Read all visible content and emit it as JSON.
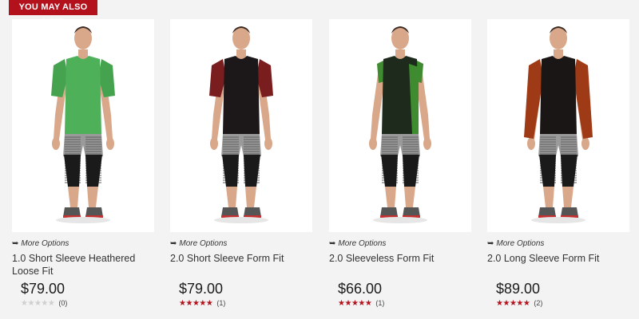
{
  "section": {
    "title": "YOU MAY ALSO LIKE"
  },
  "more_options_label": "More Options",
  "products": [
    {
      "name": "1.0 Short Sleeve Heathered Loose Fit",
      "price": "$79.00",
      "rating": 0,
      "review_count": "(0)",
      "shirt_color": "#4fb05a",
      "sleeve_color": "#45a350",
      "sleeve": "short-loose"
    },
    {
      "name": "2.0 Short Sleeve Form Fit",
      "price": "$79.00",
      "rating": 5,
      "review_count": "(1)",
      "shirt_color": "#1c1718",
      "sleeve_color": "#7a1d1f",
      "sleeve": "short"
    },
    {
      "name": "2.0 Sleeveless Form Fit",
      "price": "$66.00",
      "rating": 5,
      "review_count": "(1)",
      "shirt_color": "#1d2a1c",
      "sleeve_color": "#3e8c2f",
      "sleeve": "none"
    },
    {
      "name": "2.0 Long Sleeve Form Fit",
      "price": "$89.00",
      "rating": 5,
      "review_count": "(2)",
      "shirt_color": "#1b1616",
      "sleeve_color": "#9e3a16",
      "sleeve": "long"
    }
  ],
  "colors": {
    "brand_red": "#b3121c",
    "star_off": "#cfcfcf"
  },
  "icons": {
    "more_options": "external-arrow-icon",
    "star": "star-icon"
  }
}
